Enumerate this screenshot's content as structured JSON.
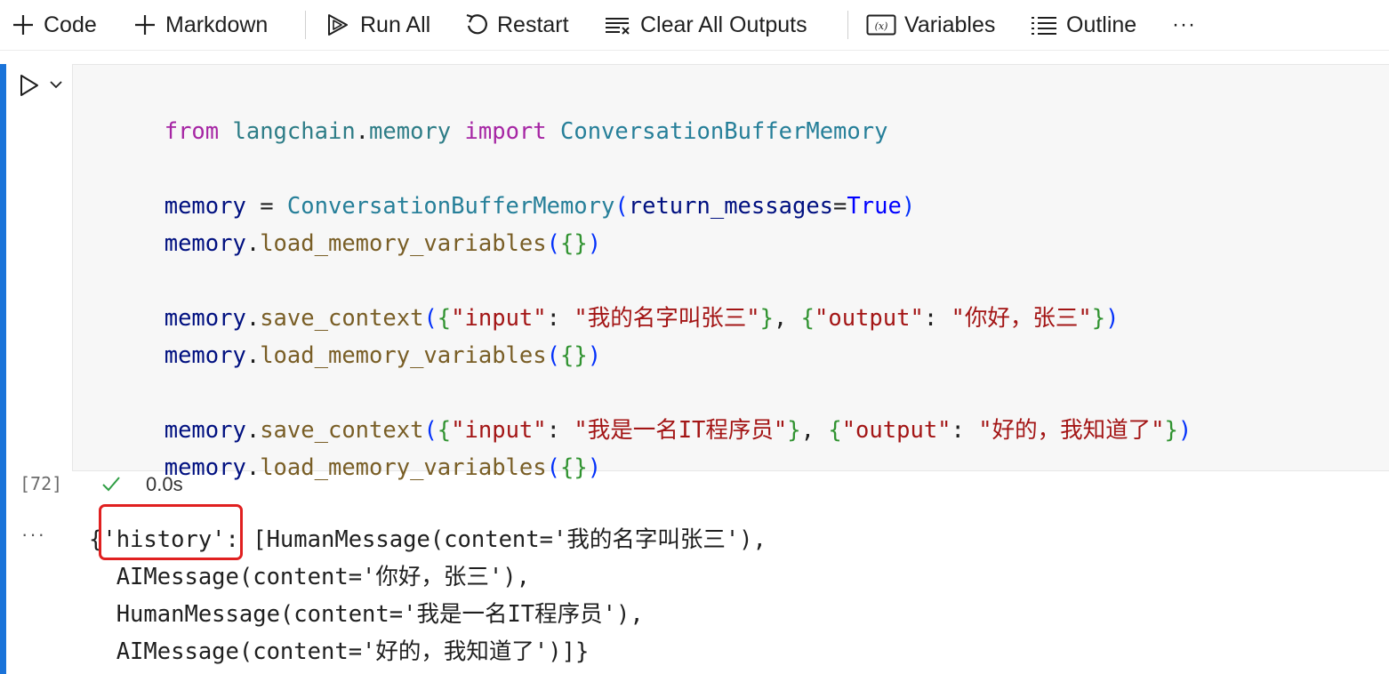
{
  "toolbar": {
    "code_label": "Code",
    "markdown_label": "Markdown",
    "run_all_label": "Run All",
    "restart_label": "Restart",
    "clear_outputs_label": "Clear All Outputs",
    "variables_label": "Variables",
    "outline_label": "Outline",
    "more_label": "···",
    "variables_icon_text": "(x)"
  },
  "cell": {
    "code_lines": [
      [
        "from",
        " ",
        "langchain",
        ".",
        "memory",
        " ",
        "import",
        " ",
        "ConversationBufferMemory"
      ],
      [
        "memory",
        " = ",
        "ConversationBufferMemory",
        "(",
        "return_messages",
        "=",
        "True",
        ")"
      ],
      [
        "memory",
        ".",
        "load_memory_variables",
        "(",
        "{}",
        ")"
      ],
      [
        "memory",
        ".",
        "save_context",
        "(",
        "{",
        "\"input\"",
        ": ",
        "\"我的名字叫张三\"",
        "}",
        ", ",
        "{",
        "\"output\"",
        ": ",
        "\"你好，张三\"",
        "}",
        ")"
      ],
      [
        "memory",
        ".",
        "load_memory_variables",
        "(",
        "{}",
        ")"
      ],
      [
        "memory",
        ".",
        "save_context",
        "(",
        "{",
        "\"input\"",
        ": ",
        "\"我是一名IT程序员\"",
        "}",
        ", ",
        "{",
        "\"output\"",
        ": ",
        "\"好的，我知道了\"",
        "}",
        ")"
      ],
      [
        "memory",
        ".",
        "load_memory_variables",
        "(",
        "{}",
        ")"
      ]
    ],
    "execution_count": "[72]",
    "status_time": "0.0s",
    "output_more": "···",
    "output_lines": [
      "{'history': [HumanMessage(content='我的名字叫张三'),",
      "  AIMessage(content='你好，张三'),",
      "  HumanMessage(content='我是一名IT程序员'),",
      "  AIMessage(content='好的，我知道了')]}"
    ]
  },
  "colors": {
    "keyword": "#a626a4",
    "module": "#2e7d87",
    "class": "#267f99",
    "variable": "#001080",
    "function": "#795e26",
    "string": "#a31515",
    "boolean": "#0000ff",
    "cell_indicator": "#1a73d9",
    "success_check": "#2f9e44",
    "highlight_box": "#e02020"
  },
  "icons": {
    "code_add": "plus-icon",
    "markdown_add": "plus-icon",
    "run_all": "run-all-icon",
    "restart": "restart-icon",
    "clear_outputs": "clear-outputs-icon",
    "variables": "variables-icon",
    "outline": "outline-icon",
    "run_cell": "play-icon",
    "collapse": "chevron-down-icon",
    "status": "check-icon"
  }
}
